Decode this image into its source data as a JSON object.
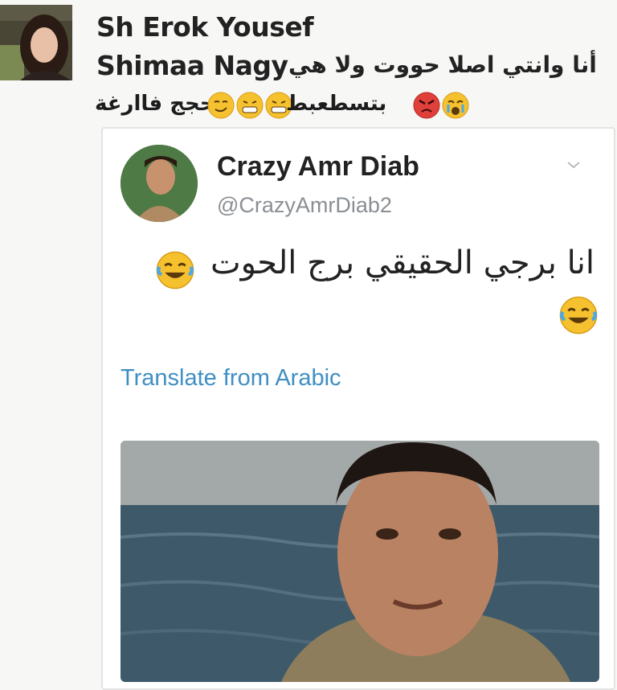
{
  "comment": {
    "author": "Sh Erok Yousef",
    "mention": "Shimaa Nagy",
    "text_line1": "أنا وانتي اصلا حووت ولا هي",
    "text_line2_a": "حجج فاارغة",
    "text_line2_b": "بتسطعبط"
  },
  "tweet": {
    "name": "Crazy Amr Diab",
    "handle": "@CrazyAmrDiab2",
    "text": "انا برجي الحقيقي برج الحوت",
    "translate_label": "Translate from Arabic"
  },
  "colors": {
    "link": "#3f8fc4",
    "handle": "#8a8f94",
    "emoji_yellow": "#f6c12e",
    "emoji_red": "#e0403a"
  }
}
